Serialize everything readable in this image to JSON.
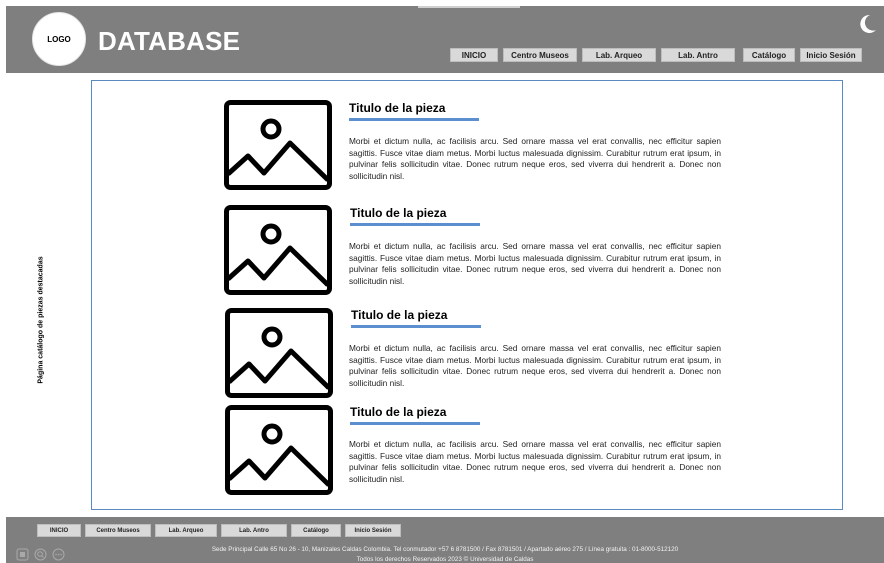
{
  "header": {
    "logo": "LOGO",
    "title": "DATABASE",
    "nav": [
      "INICIO",
      "Centro Museos",
      "Lab. Arqueo",
      "Lab. Antro",
      "Catálogo",
      "Inicio Sesión"
    ],
    "theme_icon": "moon-icon",
    "background": "#7f7f7f"
  },
  "side_label": "Página catálogo de piezas destacadas",
  "cards": [
    {
      "title": "Titulo de la pieza",
      "image_icon": "image-placeholder-icon",
      "text": "Morbi et dictum nulla, ac facilisis arcu. Sed ornare massa vel erat convallis, nec efficitur sapien sagittis. Fusce vitae diam metus. Morbi luctus malesuada dignissim. Curabitur rutrum erat ipsum, in pulvinar felis sollicitudin vitae. Donec rutrum neque eros, sed viverra dui hendrerit a. Donec non sollicitudin nisl."
    },
    {
      "title": "Titulo de la pieza",
      "image_icon": "image-placeholder-icon",
      "text": "Morbi et dictum nulla, ac facilisis arcu. Sed ornare massa vel erat convallis, nec efficitur sapien sagittis. Fusce vitae diam metus. Morbi luctus malesuada dignissim. Curabitur rutrum erat ipsum, in pulvinar felis sollicitudin vitae. Donec rutrum neque eros, sed viverra dui hendrerit a. Donec non sollicitudin nisl."
    },
    {
      "title": "Titulo de la pieza",
      "image_icon": "image-placeholder-icon",
      "text": "Morbi et dictum nulla, ac facilisis arcu. Sed ornare massa vel erat convallis, nec efficitur sapien sagittis. Fusce vitae diam metus. Morbi luctus malesuada dignissim. Curabitur rutrum erat ipsum, in pulvinar felis sollicitudin vitae. Donec rutrum neque eros, sed viverra dui hendrerit a. Donec non sollicitudin nisl."
    },
    {
      "title": "Titulo de la pieza",
      "image_icon": "image-placeholder-icon",
      "text": "Morbi et dictum nulla, ac facilisis arcu. Sed ornare massa vel erat convallis, nec efficitur sapien sagittis. Fusce vitae diam metus. Morbi luctus malesuada dignissim. Curabitur rutrum erat ipsum, in pulvinar felis sollicitudin vitae. Donec rutrum neque eros, sed viverra dui hendrerit a. Donec non sollicitudin nisl."
    }
  ],
  "footer": {
    "nav": [
      "INICIO",
      "Centro Museos",
      "Lab. Arqueo",
      "Lab. Antro",
      "Catálogo",
      "Inicio Sesión"
    ],
    "address": "Sede Principal Calle 65 No 26 - 10, Manizales Caldas Colombia. Tel conmutador +57 6 8781500 / Fax 8781501 / Apartado aéreo 275 / Línea gratuita : 01-8000-512120",
    "rights": "Todos los derechos Reservados 2023 © Universidad de Caldas",
    "icons": [
      "app-icon",
      "zoom-icon",
      "more-icon"
    ]
  },
  "colors": {
    "accent": "#5b8fd0",
    "panel_border": "#5a8ac0",
    "nav_button": "#d9d9d9"
  }
}
